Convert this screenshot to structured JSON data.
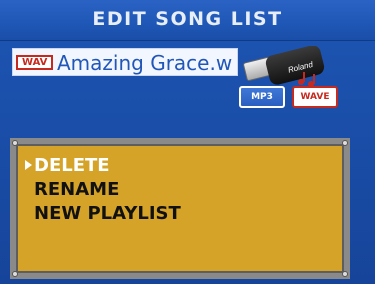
{
  "header": {
    "title": "EDIT SONG LIST"
  },
  "file": {
    "badge": "WAV",
    "name": "Amazing Grace.w"
  },
  "media": {
    "mp3_label": "MP3",
    "wave_label": "WAVE",
    "usb_brand": "Roland"
  },
  "menu": {
    "items": [
      {
        "label": "DELETE",
        "selected": true
      },
      {
        "label": "RENAME",
        "selected": false
      },
      {
        "label": "NEW PLAYLIST",
        "selected": false
      }
    ]
  },
  "colors": {
    "background": "#1a4fa8",
    "panel": "#d6a329",
    "badge_red": "#c62a1f",
    "selected_text": "#ffffff",
    "normal_text": "#111111"
  }
}
